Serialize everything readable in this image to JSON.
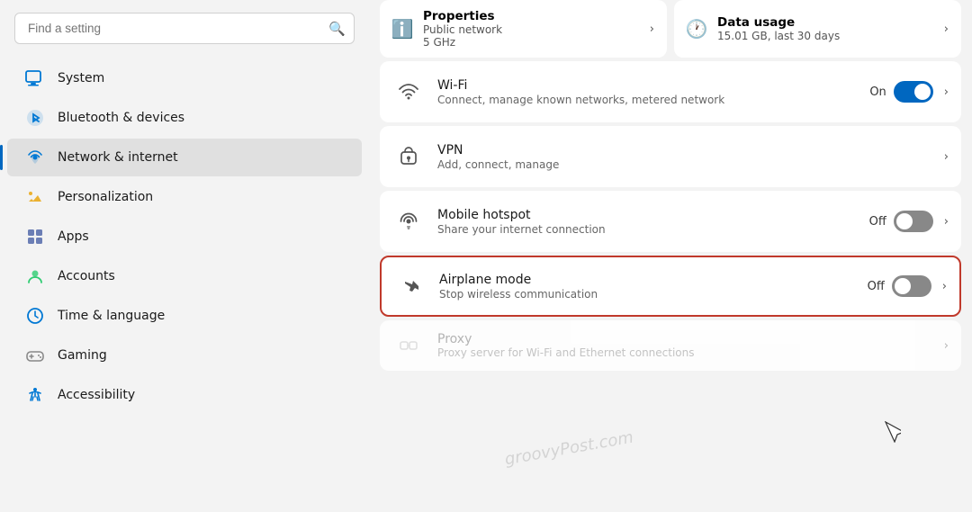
{
  "search": {
    "placeholder": "Find a setting",
    "value": ""
  },
  "nav": {
    "items": [
      {
        "id": "system",
        "label": "System",
        "icon": "system"
      },
      {
        "id": "bluetooth",
        "label": "Bluetooth & devices",
        "icon": "bluetooth"
      },
      {
        "id": "network",
        "label": "Network & internet",
        "icon": "network",
        "active": true
      },
      {
        "id": "personalization",
        "label": "Personalization",
        "icon": "personalization"
      },
      {
        "id": "apps",
        "label": "Apps",
        "icon": "apps"
      },
      {
        "id": "accounts",
        "label": "Accounts",
        "icon": "accounts"
      },
      {
        "id": "time",
        "label": "Time & language",
        "icon": "time"
      },
      {
        "id": "gaming",
        "label": "Gaming",
        "icon": "gaming"
      },
      {
        "id": "accessibility",
        "label": "Accessibility",
        "icon": "accessibility"
      }
    ]
  },
  "top_cards": [
    {
      "title": "Properties",
      "subtitle1": "Public network",
      "subtitle2": "5 GHz",
      "icon": "info"
    },
    {
      "title": "Data usage",
      "subtitle1": "15.01 GB, last 30 days",
      "icon": "clock"
    }
  ],
  "settings": [
    {
      "id": "wifi",
      "title": "Wi-Fi",
      "subtitle": "Connect, manage known networks, metered network",
      "icon": "wifi",
      "control": "toggle",
      "toggle_state": "on",
      "toggle_label": "On",
      "highlighted": false
    },
    {
      "id": "vpn",
      "title": "VPN",
      "subtitle": "Add, connect, manage",
      "icon": "vpn",
      "control": "chevron",
      "highlighted": false
    },
    {
      "id": "hotspot",
      "title": "Mobile hotspot",
      "subtitle": "Share your internet connection",
      "icon": "hotspot",
      "control": "toggle",
      "toggle_state": "off",
      "toggle_label": "Off",
      "highlighted": false
    },
    {
      "id": "airplane",
      "title": "Airplane mode",
      "subtitle": "Stop wireless communication",
      "icon": "airplane",
      "control": "toggle",
      "toggle_state": "off",
      "toggle_label": "Off",
      "highlighted": true
    }
  ],
  "proxy": {
    "title": "Proxy",
    "subtitle": "Proxy server for Wi-Fi and Ethernet connections"
  },
  "colors": {
    "accent": "#0067c0",
    "highlight_border": "#c0392b",
    "active_nav_border": "#0067c0"
  }
}
